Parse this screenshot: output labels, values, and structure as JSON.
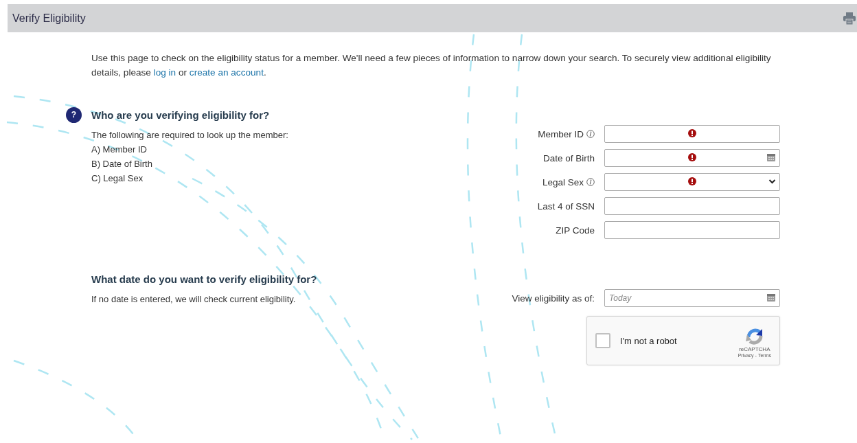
{
  "header": {
    "title": "Verify Eligibility"
  },
  "intro": [
    {
      "kind": "text",
      "text": "Use this page to check on the eligibility status for a member. We'll need a few pieces of information to narrow down your search. To securely view additional eligibility details, please"
    },
    {
      "kind": "link",
      "text": "log in"
    },
    {
      "kind": "text",
      "text": "or"
    },
    {
      "kind": "link",
      "text": "create an account"
    },
    {
      "kind": "text",
      "text": "."
    }
  ],
  "sections": [
    {
      "badge": "?",
      "heading": "Who are you verifying eligibility for?",
      "lines": [
        "The following are required to look up the member:",
        "A) Member ID",
        "B) Date of Birth",
        "C) Legal Sex"
      ],
      "fields": [
        {
          "label": "Member ID",
          "info": true,
          "required": true,
          "kind": "text"
        },
        {
          "label": "Date of Birth",
          "info": false,
          "required": true,
          "kind": "date"
        },
        {
          "label": "Legal Sex",
          "info": true,
          "required": true,
          "kind": "select"
        },
        {
          "label": "Last 4 of SSN",
          "info": false,
          "required": false,
          "kind": "text"
        },
        {
          "label": "ZIP Code",
          "info": false,
          "required": false,
          "kind": "text"
        }
      ]
    },
    {
      "heading": "What date do you want to verify eligibility for?",
      "lines": [
        "If no date is entered, we will check current eligibility."
      ],
      "fields": [
        {
          "label": "View eligibility as of:",
          "info": false,
          "required": false,
          "kind": "date",
          "placeholder": "Today"
        }
      ]
    }
  ],
  "captcha": {
    "checked": false,
    "label": "I'm not a robot",
    "brand": "reCAPTCHA",
    "links": [
      "Privacy",
      "Terms"
    ],
    "separator": "-"
  }
}
